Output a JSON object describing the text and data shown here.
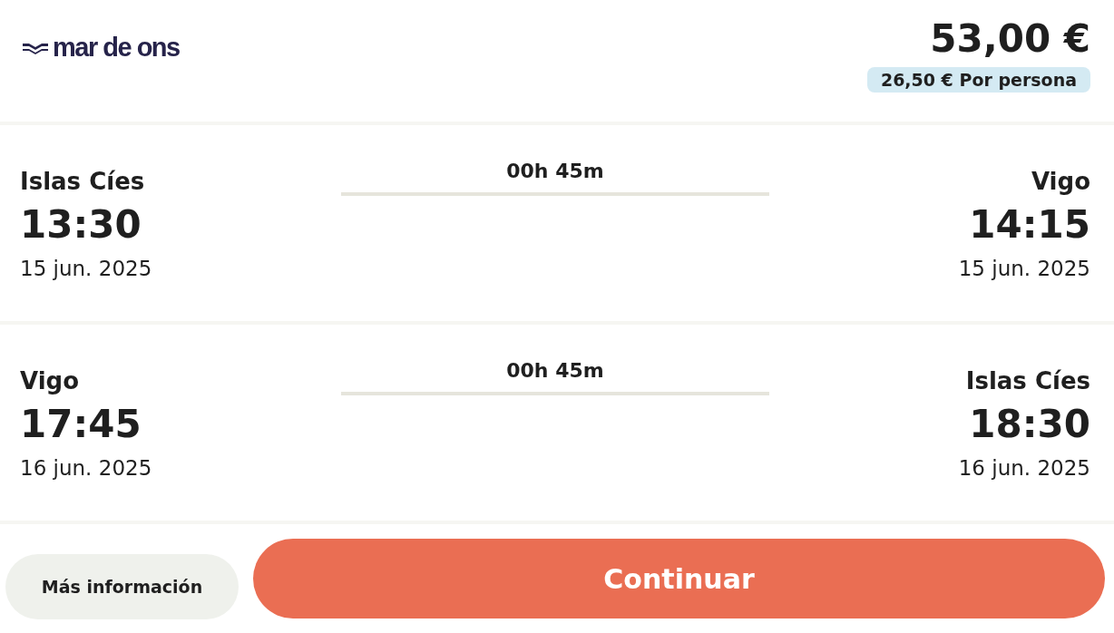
{
  "brand": {
    "name": "mar de ons"
  },
  "price": {
    "total": "53,00 €",
    "per_person": "26,50 € Por persona"
  },
  "legs": [
    {
      "origin": "Islas Cíes",
      "departure_time": "13:30",
      "departure_date": "15 jun. 2025",
      "duration": "00h 45m",
      "destination": "Vigo",
      "arrival_time": "14:15",
      "arrival_date": "15 jun. 2025"
    },
    {
      "origin": "Vigo",
      "departure_time": "17:45",
      "departure_date": "16 jun. 2025",
      "duration": "00h 45m",
      "destination": "Islas Cíes",
      "arrival_time": "18:30",
      "arrival_date": "16 jun. 2025"
    }
  ],
  "buttons": {
    "info": "Más información",
    "continue": "Continuar"
  }
}
